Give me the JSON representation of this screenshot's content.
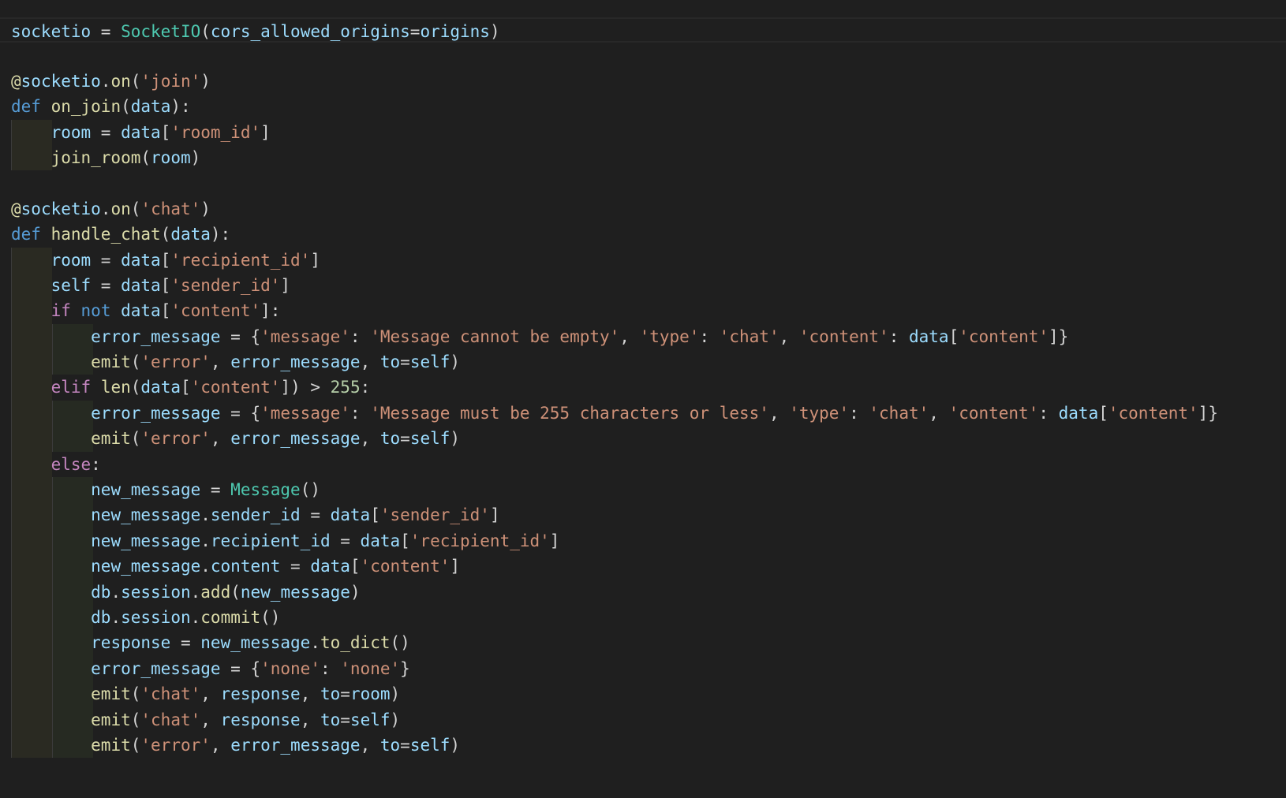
{
  "colors": {
    "background": "#1f1f1f",
    "variable": "#9cdcfe",
    "function": "#dcdcaa",
    "class": "#4ec9b0",
    "keyword": "#569cd6",
    "control": "#c586c0",
    "string": "#ce9178",
    "number": "#b5cea8",
    "plain": "#d4d4d4"
  },
  "editor": {
    "lines": [
      {
        "indent": 0,
        "current": true,
        "tokens": [
          [
            "var",
            "socketio"
          ],
          [
            "op",
            " = "
          ],
          [
            "cls",
            "SocketIO"
          ],
          [
            "op",
            "("
          ],
          [
            "var",
            "cors_allowed_origins"
          ],
          [
            "op",
            "="
          ],
          [
            "var",
            "origins"
          ],
          [
            "op",
            ")"
          ]
        ]
      },
      {
        "indent": 0,
        "tokens": []
      },
      {
        "indent": 0,
        "tokens": [
          [
            "dec",
            "@"
          ],
          [
            "var",
            "socketio"
          ],
          [
            "op",
            "."
          ],
          [
            "fn",
            "on"
          ],
          [
            "op",
            "("
          ],
          [
            "str",
            "'join'"
          ],
          [
            "op",
            ")"
          ]
        ]
      },
      {
        "indent": 0,
        "tokens": [
          [
            "kw",
            "def"
          ],
          [
            "op",
            " "
          ],
          [
            "fn",
            "on_join"
          ],
          [
            "op",
            "("
          ],
          [
            "var",
            "data"
          ],
          [
            "op",
            "):"
          ]
        ]
      },
      {
        "indent": 1,
        "tokens": [
          [
            "var",
            "room"
          ],
          [
            "op",
            " = "
          ],
          [
            "var",
            "data"
          ],
          [
            "op",
            "["
          ],
          [
            "str",
            "'room_id'"
          ],
          [
            "op",
            "]"
          ]
        ]
      },
      {
        "indent": 1,
        "tokens": [
          [
            "fn",
            "join_room"
          ],
          [
            "op",
            "("
          ],
          [
            "var",
            "room"
          ],
          [
            "op",
            ")"
          ]
        ]
      },
      {
        "indent": 0,
        "tokens": []
      },
      {
        "indent": 0,
        "tokens": [
          [
            "dec",
            "@"
          ],
          [
            "var",
            "socketio"
          ],
          [
            "op",
            "."
          ],
          [
            "fn",
            "on"
          ],
          [
            "op",
            "("
          ],
          [
            "str",
            "'chat'"
          ],
          [
            "op",
            ")"
          ]
        ]
      },
      {
        "indent": 0,
        "tokens": [
          [
            "kw",
            "def"
          ],
          [
            "op",
            " "
          ],
          [
            "fn",
            "handle_chat"
          ],
          [
            "op",
            "("
          ],
          [
            "var",
            "data"
          ],
          [
            "op",
            "):"
          ]
        ]
      },
      {
        "indent": 1,
        "tokens": [
          [
            "var",
            "room"
          ],
          [
            "op",
            " = "
          ],
          [
            "var",
            "data"
          ],
          [
            "op",
            "["
          ],
          [
            "str",
            "'recipient_id'"
          ],
          [
            "op",
            "]"
          ]
        ]
      },
      {
        "indent": 1,
        "tokens": [
          [
            "var",
            "self"
          ],
          [
            "op",
            " = "
          ],
          [
            "var",
            "data"
          ],
          [
            "op",
            "["
          ],
          [
            "str",
            "'sender_id'"
          ],
          [
            "op",
            "]"
          ]
        ]
      },
      {
        "indent": 1,
        "tokens": [
          [
            "ctl",
            "if"
          ],
          [
            "op",
            " "
          ],
          [
            "kw",
            "not"
          ],
          [
            "op",
            " "
          ],
          [
            "var",
            "data"
          ],
          [
            "op",
            "["
          ],
          [
            "str",
            "'content'"
          ],
          [
            "op",
            "]:"
          ]
        ]
      },
      {
        "indent": 2,
        "tokens": [
          [
            "var",
            "error_message"
          ],
          [
            "op",
            " = {"
          ],
          [
            "str",
            "'message'"
          ],
          [
            "op",
            ": "
          ],
          [
            "str",
            "'Message cannot be empty'"
          ],
          [
            "op",
            ", "
          ],
          [
            "str",
            "'type'"
          ],
          [
            "op",
            ": "
          ],
          [
            "str",
            "'chat'"
          ],
          [
            "op",
            ", "
          ],
          [
            "str",
            "'content'"
          ],
          [
            "op",
            ": "
          ],
          [
            "var",
            "data"
          ],
          [
            "op",
            "["
          ],
          [
            "str",
            "'content'"
          ],
          [
            "op",
            "]}"
          ]
        ]
      },
      {
        "indent": 2,
        "tokens": [
          [
            "fn",
            "emit"
          ],
          [
            "op",
            "("
          ],
          [
            "str",
            "'error'"
          ],
          [
            "op",
            ", "
          ],
          [
            "var",
            "error_message"
          ],
          [
            "op",
            ", "
          ],
          [
            "var",
            "to"
          ],
          [
            "op",
            "="
          ],
          [
            "var",
            "self"
          ],
          [
            "op",
            ")"
          ]
        ]
      },
      {
        "indent": 1,
        "tokens": [
          [
            "ctl",
            "elif"
          ],
          [
            "op",
            " "
          ],
          [
            "fn",
            "len"
          ],
          [
            "op",
            "("
          ],
          [
            "var",
            "data"
          ],
          [
            "op",
            "["
          ],
          [
            "str",
            "'content'"
          ],
          [
            "op",
            "]) > "
          ],
          [
            "num",
            "255"
          ],
          [
            "op",
            ":"
          ]
        ]
      },
      {
        "indent": 2,
        "tokens": [
          [
            "var",
            "error_message"
          ],
          [
            "op",
            " = {"
          ],
          [
            "str",
            "'message'"
          ],
          [
            "op",
            ": "
          ],
          [
            "str",
            "'Message must be 255 characters or less'"
          ],
          [
            "op",
            ", "
          ],
          [
            "str",
            "'type'"
          ],
          [
            "op",
            ": "
          ],
          [
            "str",
            "'chat'"
          ],
          [
            "op",
            ", "
          ],
          [
            "str",
            "'content'"
          ],
          [
            "op",
            ": "
          ],
          [
            "var",
            "data"
          ],
          [
            "op",
            "["
          ],
          [
            "str",
            "'content'"
          ],
          [
            "op",
            "]}"
          ]
        ]
      },
      {
        "indent": 2,
        "tokens": [
          [
            "fn",
            "emit"
          ],
          [
            "op",
            "("
          ],
          [
            "str",
            "'error'"
          ],
          [
            "op",
            ", "
          ],
          [
            "var",
            "error_message"
          ],
          [
            "op",
            ", "
          ],
          [
            "var",
            "to"
          ],
          [
            "op",
            "="
          ],
          [
            "var",
            "self"
          ],
          [
            "op",
            ")"
          ]
        ]
      },
      {
        "indent": 1,
        "tokens": [
          [
            "ctl",
            "else"
          ],
          [
            "op",
            ":"
          ]
        ]
      },
      {
        "indent": 2,
        "tokens": [
          [
            "var",
            "new_message"
          ],
          [
            "op",
            " = "
          ],
          [
            "cls",
            "Message"
          ],
          [
            "op",
            "()"
          ]
        ]
      },
      {
        "indent": 2,
        "tokens": [
          [
            "var",
            "new_message"
          ],
          [
            "op",
            "."
          ],
          [
            "var",
            "sender_id"
          ],
          [
            "op",
            " = "
          ],
          [
            "var",
            "data"
          ],
          [
            "op",
            "["
          ],
          [
            "str",
            "'sender_id'"
          ],
          [
            "op",
            "]"
          ]
        ]
      },
      {
        "indent": 2,
        "tokens": [
          [
            "var",
            "new_message"
          ],
          [
            "op",
            "."
          ],
          [
            "var",
            "recipient_id"
          ],
          [
            "op",
            " = "
          ],
          [
            "var",
            "data"
          ],
          [
            "op",
            "["
          ],
          [
            "str",
            "'recipient_id'"
          ],
          [
            "op",
            "]"
          ]
        ]
      },
      {
        "indent": 2,
        "tokens": [
          [
            "var",
            "new_message"
          ],
          [
            "op",
            "."
          ],
          [
            "var",
            "content"
          ],
          [
            "op",
            " = "
          ],
          [
            "var",
            "data"
          ],
          [
            "op",
            "["
          ],
          [
            "str",
            "'content'"
          ],
          [
            "op",
            "]"
          ]
        ]
      },
      {
        "indent": 2,
        "tokens": [
          [
            "var",
            "db"
          ],
          [
            "op",
            "."
          ],
          [
            "var",
            "session"
          ],
          [
            "op",
            "."
          ],
          [
            "fn",
            "add"
          ],
          [
            "op",
            "("
          ],
          [
            "var",
            "new_message"
          ],
          [
            "op",
            ")"
          ]
        ]
      },
      {
        "indent": 2,
        "tokens": [
          [
            "var",
            "db"
          ],
          [
            "op",
            "."
          ],
          [
            "var",
            "session"
          ],
          [
            "op",
            "."
          ],
          [
            "fn",
            "commit"
          ],
          [
            "op",
            "()"
          ]
        ]
      },
      {
        "indent": 2,
        "tokens": [
          [
            "var",
            "response"
          ],
          [
            "op",
            " = "
          ],
          [
            "var",
            "new_message"
          ],
          [
            "op",
            "."
          ],
          [
            "fn",
            "to_dict"
          ],
          [
            "op",
            "()"
          ]
        ]
      },
      {
        "indent": 2,
        "tokens": [
          [
            "var",
            "error_message"
          ],
          [
            "op",
            " = {"
          ],
          [
            "str",
            "'none'"
          ],
          [
            "op",
            ": "
          ],
          [
            "str",
            "'none'"
          ],
          [
            "op",
            "}"
          ]
        ]
      },
      {
        "indent": 2,
        "tokens": [
          [
            "fn",
            "emit"
          ],
          [
            "op",
            "("
          ],
          [
            "str",
            "'chat'"
          ],
          [
            "op",
            ", "
          ],
          [
            "var",
            "response"
          ],
          [
            "op",
            ", "
          ],
          [
            "var",
            "to"
          ],
          [
            "op",
            "="
          ],
          [
            "var",
            "room"
          ],
          [
            "op",
            ")"
          ]
        ]
      },
      {
        "indent": 2,
        "tokens": [
          [
            "fn",
            "emit"
          ],
          [
            "op",
            "("
          ],
          [
            "str",
            "'chat'"
          ],
          [
            "op",
            ", "
          ],
          [
            "var",
            "response"
          ],
          [
            "op",
            ", "
          ],
          [
            "var",
            "to"
          ],
          [
            "op",
            "="
          ],
          [
            "var",
            "self"
          ],
          [
            "op",
            ")"
          ]
        ]
      },
      {
        "indent": 2,
        "tokens": [
          [
            "fn",
            "emit"
          ],
          [
            "op",
            "("
          ],
          [
            "str",
            "'error'"
          ],
          [
            "op",
            ", "
          ],
          [
            "var",
            "error_message"
          ],
          [
            "op",
            ", "
          ],
          [
            "var",
            "to"
          ],
          [
            "op",
            "="
          ],
          [
            "var",
            "self"
          ],
          [
            "op",
            ")"
          ]
        ]
      }
    ]
  }
}
